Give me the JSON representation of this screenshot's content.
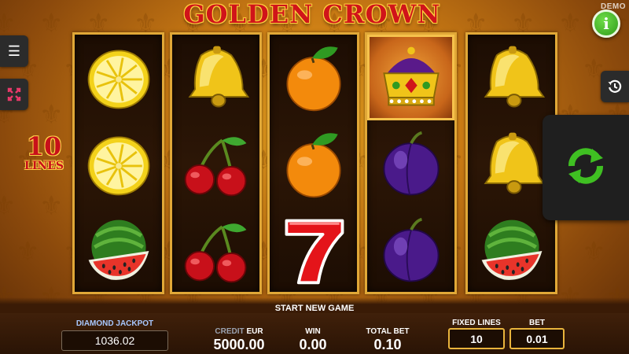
{
  "header": {
    "title": "GOLDEN CROWN",
    "demo_label": "DEMO",
    "info_label": "i"
  },
  "icons": {
    "menu": "hamburger-icon",
    "expand": "expand-arrows-icon",
    "history": "history-icon",
    "spin": "spin-arrows-icon",
    "info": "info-icon"
  },
  "lines_badge": {
    "number": "10",
    "label": "LINES"
  },
  "reels": [
    [
      "lemon",
      "lemon",
      "watermelon"
    ],
    [
      "bell",
      "cherries",
      "cherries"
    ],
    [
      "orange",
      "orange",
      "seven"
    ],
    [
      "crown",
      "plum",
      "plum"
    ],
    [
      "bell",
      "bell",
      "watermelon"
    ]
  ],
  "status": {
    "message": "START NEW GAME"
  },
  "bottom": {
    "jackpot_label": "DIAMOND JACKPOT",
    "jackpot_value": "1036.02",
    "credit_label": "CREDIT",
    "currency": "EUR",
    "credit_value": "5000.00",
    "win_label": "WIN",
    "win_value": "0.00",
    "total_bet_label": "TOTAL BET",
    "total_bet_value": "0.10",
    "fixed_lines_label": "FIXED LINES",
    "fixed_lines_value": "10",
    "bet_label": "BET",
    "bet_value": "0.01"
  },
  "colors": {
    "accent_green": "#3fbf22",
    "frame_gold": "#e1a837",
    "title_red": "#d0141a"
  }
}
